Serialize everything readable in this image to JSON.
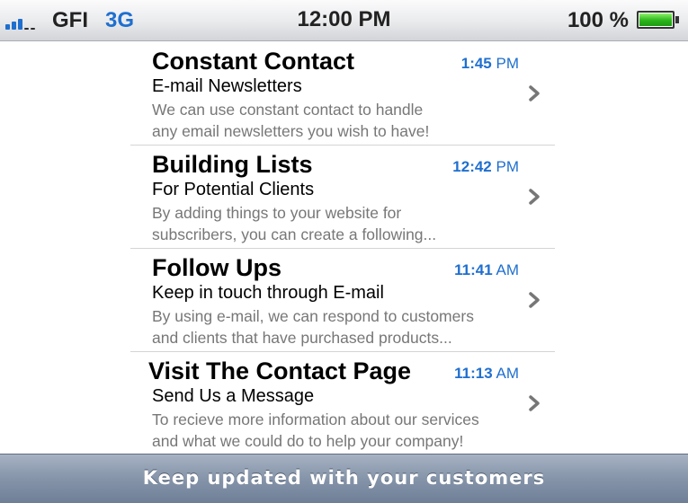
{
  "status_bar": {
    "signal_bars": 3,
    "carrier": "GFI",
    "network": "3G",
    "time": "12:00 PM",
    "battery_percent": "100 %",
    "battery_level": 1.0,
    "signal_icon": "signal-strength-icon",
    "battery_icon": "battery-icon"
  },
  "messages": [
    {
      "title": "Constant Contact",
      "time": "1:45",
      "ampm": "PM",
      "subtitle": "E-mail Newsletters",
      "preview_line1": "We can use constant contact to handle",
      "preview_line2": "any email newsletters you wish to have!"
    },
    {
      "title": "Building Lists",
      "time": "12:42",
      "ampm": "PM",
      "subtitle": "For Potential Clients",
      "preview_line1": "By adding things to your website for",
      "preview_line2": "subscribers, you can create a following..."
    },
    {
      "title": "Follow Ups",
      "time": "11:41",
      "ampm": "AM",
      "subtitle": "Keep in touch through E-mail",
      "preview_line1": "By using e-mail, we can respond to customers",
      "preview_line2": "and clients that have purchased products..."
    },
    {
      "title": "Visit The Contact Page",
      "time": "11:13",
      "ampm": "AM",
      "subtitle": "Send Us a Message",
      "preview_line1": "To recieve more information about our services",
      "preview_line2": "and what we could do to help your company!"
    }
  ],
  "footer": {
    "text": "Keep updated with your customers"
  },
  "colors": {
    "accent": "#1f6fcf",
    "battery_green": "#2bb51b",
    "preview_gray": "#777777",
    "footer_blue_gray": "#8594a9"
  }
}
